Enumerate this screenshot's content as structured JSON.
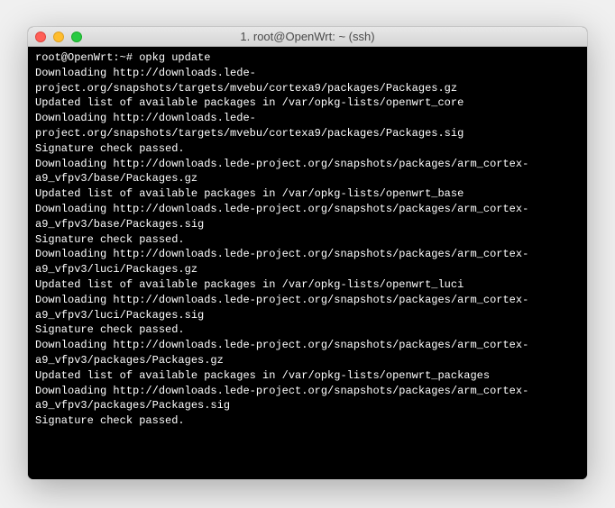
{
  "window": {
    "title": "1. root@OpenWrt: ~ (ssh)"
  },
  "terminal": {
    "prompt": "root@OpenWrt:~# ",
    "command": "opkg update",
    "lines": [
      "Downloading http://downloads.lede-project.org/snapshots/targets/mvebu/cortexa9/packages/Packages.gz",
      "Updated list of available packages in /var/opkg-lists/openwrt_core",
      "Downloading http://downloads.lede-project.org/snapshots/targets/mvebu/cortexa9/packages/Packages.sig",
      "Signature check passed.",
      "Downloading http://downloads.lede-project.org/snapshots/packages/arm_cortex-a9_vfpv3/base/Packages.gz",
      "Updated list of available packages in /var/opkg-lists/openwrt_base",
      "Downloading http://downloads.lede-project.org/snapshots/packages/arm_cortex-a9_vfpv3/base/Packages.sig",
      "Signature check passed.",
      "Downloading http://downloads.lede-project.org/snapshots/packages/arm_cortex-a9_vfpv3/luci/Packages.gz",
      "Updated list of available packages in /var/opkg-lists/openwrt_luci",
      "Downloading http://downloads.lede-project.org/snapshots/packages/arm_cortex-a9_vfpv3/luci/Packages.sig",
      "Signature check passed.",
      "Downloading http://downloads.lede-project.org/snapshots/packages/arm_cortex-a9_vfpv3/packages/Packages.gz",
      "Updated list of available packages in /var/opkg-lists/openwrt_packages",
      "Downloading http://downloads.lede-project.org/snapshots/packages/arm_cortex-a9_vfpv3/packages/Packages.sig",
      "Signature check passed."
    ]
  }
}
